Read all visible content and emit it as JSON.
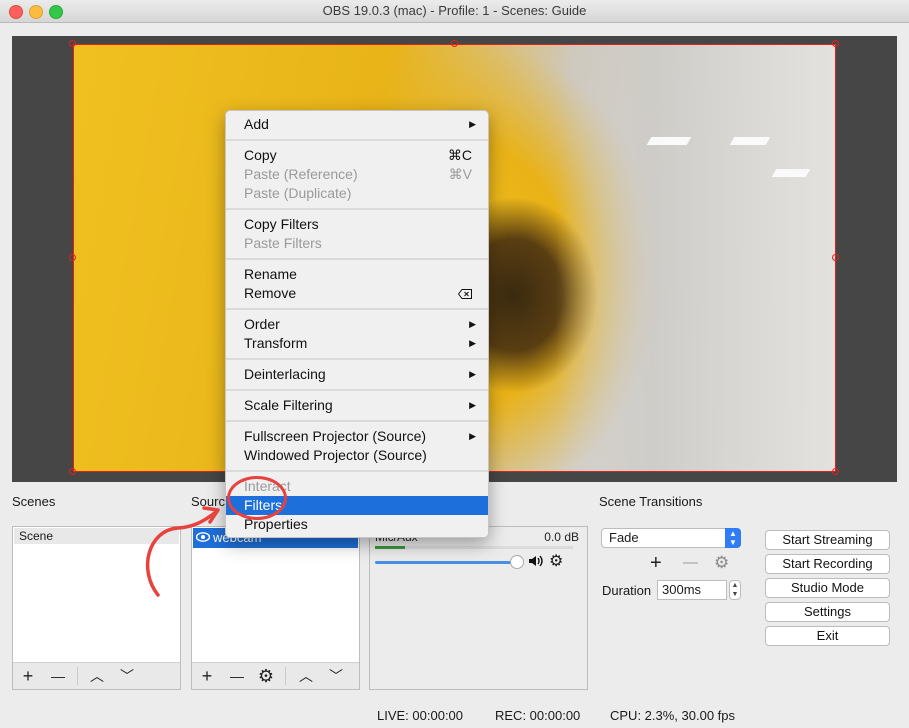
{
  "window": {
    "title": "OBS 19.0.3 (mac) - Profile: 1 - Scenes: Guide"
  },
  "docks": {
    "scenes_title": "Scenes",
    "sources_title": "Sourc",
    "transitions_title": "Scene Transitions"
  },
  "scenes": {
    "items": [
      "Scene"
    ]
  },
  "sources": {
    "items": [
      {
        "name": "webcam",
        "visible_icon": "eye-icon"
      }
    ]
  },
  "mixer": {
    "channel": "Mic/Aux",
    "level": "0.0 dB",
    "meter_fraction": 0.15,
    "volume_fraction": 1.0
  },
  "transitions": {
    "selected": "Fade",
    "duration_label": "Duration",
    "duration_value": "300ms"
  },
  "controls": {
    "start_streaming": "Start Streaming",
    "start_recording": "Start Recording",
    "studio_mode": "Studio Mode",
    "settings": "Settings",
    "exit": "Exit"
  },
  "status": {
    "live": "LIVE: 00:00:00",
    "rec": "REC: 00:00:00",
    "cpu": "CPU: 2.3%, 30.00 fps"
  },
  "context_menu": {
    "add": "Add",
    "copy": "Copy",
    "copy_sc": "⌘C",
    "paste_ref": "Paste (Reference)",
    "paste_ref_sc": "⌘V",
    "paste_dup": "Paste (Duplicate)",
    "copy_filters": "Copy Filters",
    "paste_filters": "Paste Filters",
    "rename": "Rename",
    "remove": "Remove",
    "order": "Order",
    "transform": "Transform",
    "deinterlacing": "Deinterlacing",
    "scale_filtering": "Scale Filtering",
    "fullscreen_projector": "Fullscreen Projector (Source)",
    "windowed_projector": "Windowed Projector (Source)",
    "interact": "Interact",
    "filters": "Filters",
    "properties": "Properties"
  },
  "icons": {
    "add": "+",
    "remove": "—",
    "up": "︿",
    "down": "﹀",
    "gear": "⚙",
    "speaker": "🔊"
  },
  "colors": {
    "selection": "#1d6fdc",
    "bounding_box": "#e0201c",
    "annotation": "#e8423e"
  }
}
